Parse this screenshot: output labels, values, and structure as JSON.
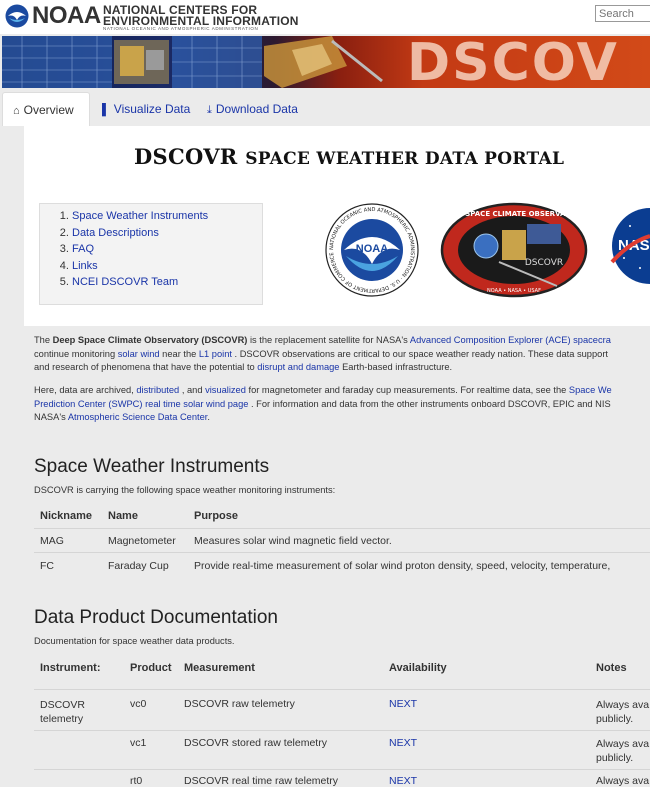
{
  "header": {
    "logo_word": "NOAA",
    "logo_line1": "NATIONAL CENTERS FOR",
    "logo_line2": "ENVIRONMENTAL INFORMATION",
    "logo_line3": "NATIONAL OCEANIC AND ATMOSPHERIC ADMINISTRATION",
    "search_placeholder": "Search"
  },
  "banner": {
    "text": "DSCOV"
  },
  "tabs": [
    {
      "label": "Overview",
      "icon": "home-icon"
    },
    {
      "label": "Visualize Data",
      "icon": "bar-chart-icon"
    },
    {
      "label": "Download Data",
      "icon": "download-icon"
    }
  ],
  "page": {
    "title_part1": "DSCOVR",
    "title_part2": "Space Weather Data Portal"
  },
  "toc": [
    "Space Weather Instruments",
    "Data Descriptions",
    "FAQ",
    "Links",
    "NCEI DSCOVR Team"
  ],
  "logos": {
    "noaa_ring": "NATIONAL OCEANIC AND ATMOSPHERIC ADMINISTRATION · U.S. DEPARTMENT OF COMMERCE",
    "noaa_center": "NOAA",
    "dscovr_ring": "DEEP SPACE CLIMATE OBSERVATORY",
    "dscovr_center": "DSCOVR",
    "dscovr_bottom": "NOAA • NASA • USAF",
    "nasa": "NASA"
  },
  "intro": {
    "p1a": "The ",
    "p1b": "Deep Space Climate Observatory (DSCOVR)",
    "p1c": " is the replacement satellite for NASA's ",
    "p1d": "Advanced Composition Explorer (ACE) spacecra",
    "p1e": "continue monitoring ",
    "p1f": "solar wind",
    "p1g": " near the ",
    "p1h": "L1 point",
    "p1i": " . DSCOVR observations are critical to our space weather ready nation. These data support",
    "p1j": "and research of phenomena that have the potential to ",
    "p1k": "disrupt and damage",
    "p1l": " Earth-based infrastructure.",
    "p2a": "Here, data are archived, ",
    "p2b": "distributed",
    "p2c": " , and ",
    "p2d": "visualized",
    "p2e": " for magnetometer and faraday cup measurements. For realtime data, see the ",
    "p2f": "Space We",
    "p2g": "Prediction Center (SWPC) real time solar wind page",
    "p2h": " . For information and data from the other instruments onboard DSCOVR, EPIC and NIS",
    "p2i": "NASA's ",
    "p2j": "Atmospheric Science Data Center",
    "p2k": "."
  },
  "instruments": {
    "heading": "Space Weather Instruments",
    "intro": "DSCOVR is carrying the following space weather monitoring instruments:",
    "columns": [
      "Nickname",
      "Name",
      "Purpose"
    ],
    "rows": [
      [
        "MAG",
        "Magnetometer",
        "Measures solar wind magnetic field vector."
      ],
      [
        "FC",
        "Faraday Cup",
        "Provide real-time measurement of solar wind proton density, speed, velocity, temperature,"
      ]
    ]
  },
  "docs": {
    "heading": "Data Product Documentation",
    "intro": "Documentation for space weather data products.",
    "columns": [
      "Instrument:",
      "Product",
      "Measurement",
      "Availability",
      "Notes"
    ],
    "rows": [
      {
        "instrument": "DSCOVR telemetry",
        "product": "vc0",
        "measurement": "DSCOVR raw telemetry",
        "availability": "NEXT",
        "notes1": "Always ava",
        "notes2": "publicly."
      },
      {
        "instrument": "",
        "product": "vc1",
        "measurement": "DSCOVR stored raw telemetry",
        "availability": "NEXT",
        "notes1": "Always ava",
        "notes2": "publicly."
      },
      {
        "instrument": "",
        "product": "rt0",
        "measurement": "DSCOVR real time raw telemetry",
        "availability": "NEXT",
        "notes1": "Always ava",
        "notes2": ""
      }
    ]
  },
  "colors": {
    "link": "#1a35a8",
    "text": "#333333",
    "background": "#ebebeb"
  }
}
